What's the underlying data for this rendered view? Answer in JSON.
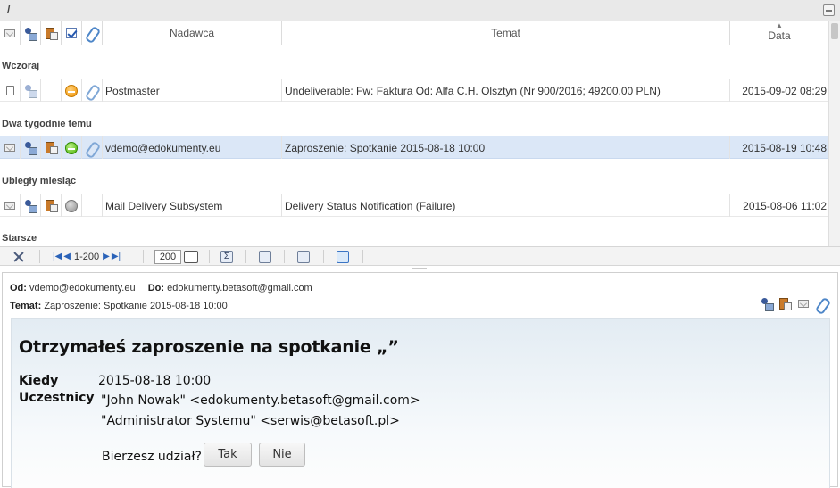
{
  "path": "/",
  "columns": {
    "sender": "Nadawca",
    "subject": "Temat",
    "date": "Data"
  },
  "groups": {
    "yesterday": "Wczoraj",
    "two_weeks": "Dwa tygodnie temu",
    "last_month": "Ubiegły miesiąc",
    "older": "Starsze"
  },
  "messages": [
    {
      "sender": "Postmaster",
      "subject": "Undeliverable: Fw: Faktura Od: Alfa C.H. Olsztyn (Nr 900/2016; 49200.00 PLN)",
      "date": "2015-09-02 08:29",
      "status": "orange"
    },
    {
      "sender": "vdemo@edokumenty.eu",
      "subject": "Zaproszenie: Spotkanie 2015-08-18 10:00",
      "date": "2015-08-19 10:48",
      "status": "green"
    },
    {
      "sender": "Mail Delivery Subsystem",
      "subject": "Delivery Status Notification (Failure)",
      "date": "2015-08-06 11:02",
      "status": "gray"
    }
  ],
  "pager": {
    "range": "1-200",
    "page_size": "200"
  },
  "preview": {
    "from_label": "Od:",
    "from": "vdemo@edokumenty.eu",
    "to_label": "Do:",
    "to": "edokumenty.betasoft@gmail.com",
    "subject_label": "Temat:",
    "subject": "Zaproszenie: Spotkanie 2015-08-18 10:00"
  },
  "invitation": {
    "title": "Otrzymałeś zaproszenie na spotkanie „”",
    "when_label": "Kiedy",
    "when": "2015-08-18 10:00",
    "participants_label": "Uczestnicy",
    "participants": [
      "\"John Nowak\" <edokumenty.betasoft@gmail.com>",
      "\"Administrator Systemu\" <serwis@betasoft.pl>"
    ],
    "question": "Bierzesz udział?",
    "yes": "Tak",
    "no": "Nie"
  },
  "colors": {
    "selected_row": "#dbe7f7",
    "link_blue": "#2a62b8"
  }
}
